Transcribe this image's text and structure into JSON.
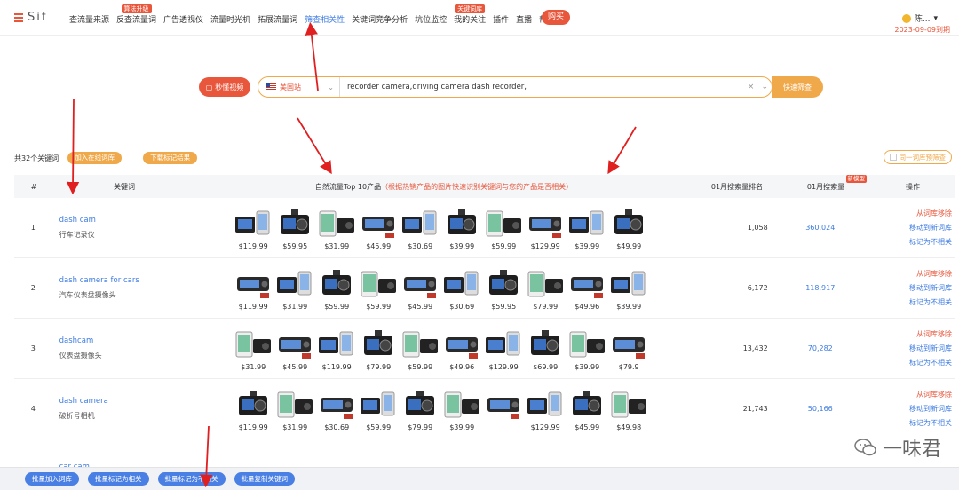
{
  "header": {
    "logo": "Sif",
    "nav": [
      {
        "label": "查流量来源",
        "badge": ""
      },
      {
        "label": "反查流量词",
        "badge": "算法升级"
      },
      {
        "label": "广告透视仪",
        "badge": ""
      },
      {
        "label": "流量时光机",
        "badge": ""
      },
      {
        "label": "拓展流量词",
        "badge": ""
      },
      {
        "label": "筛查相关性",
        "badge": "",
        "active": true
      },
      {
        "label": "关键词竞争分析",
        "badge": ""
      },
      {
        "label": "坑位监控",
        "badge": ""
      },
      {
        "label": "我的关注",
        "badge": "关键词库"
      },
      {
        "label": "插件",
        "badge": ""
      },
      {
        "label": "直播",
        "badge": ""
      },
      {
        "label": "帮助",
        "badge": ""
      }
    ],
    "buy_label": "购买",
    "user_name": "陈...",
    "expire_text": "2023-09-09到期"
  },
  "search": {
    "video_label": "秒懂视频",
    "site_label": "美国站",
    "query": "recorder camera,driving camera dash recorder,",
    "clear_icon": "×",
    "submit_label": "快速筛查"
  },
  "toolbar": {
    "total": "共32个关键词",
    "add_to_library": "加入在线词库",
    "download_results": "下载标记结果",
    "filter_label": "同一词库预筛查"
  },
  "table": {
    "headers": {
      "num": "#",
      "keyword": "关键词",
      "products": "自然流量Top 10产品",
      "products_hint": "（根据热销产品的图片快速识别关键词与您的产品是否相关）",
      "rank": "01月搜索量排名",
      "volume": "01月搜索量",
      "volume_tag": "新模型",
      "op": "操作"
    },
    "ops": {
      "remove": "从词库移除",
      "move": "移动到新词库",
      "mark": "标记为不相关"
    },
    "rows": [
      {
        "num": "1",
        "kw_en": "dash cam",
        "kw_cn": "行车记录仪",
        "rank": "1,058",
        "volume": "360,024",
        "prices": [
          "$119.99",
          "$59.95",
          "$31.99",
          "$45.99",
          "$30.69",
          "$39.99",
          "$59.99",
          "$129.99",
          "$39.99",
          "$49.99"
        ]
      },
      {
        "num": "2",
        "kw_en": "dash camera for cars",
        "kw_cn": "汽车仪表盘摄像头",
        "rank": "6,172",
        "volume": "118,917",
        "prices": [
          "$119.99",
          "$31.99",
          "$59.99",
          "$59.99",
          "$45.99",
          "$30.69",
          "$59.95",
          "$79.99",
          "$49.96",
          "$39.99"
        ]
      },
      {
        "num": "3",
        "kw_en": "dashcam",
        "kw_cn": "仪表盘摄像头",
        "rank": "13,432",
        "volume": "70,282",
        "prices": [
          "$31.99",
          "$45.99",
          "$119.99",
          "$79.99",
          "$59.99",
          "$49.96",
          "$129.99",
          "$69.99",
          "$39.99",
          "$79.9"
        ]
      },
      {
        "num": "4",
        "kw_en": "dash camera",
        "kw_cn": "破折号相机",
        "rank": "21,743",
        "volume": "50,166",
        "prices": [
          "$119.99",
          "$31.99",
          "$30.69",
          "$59.99",
          "$79.99",
          "$39.99",
          "",
          "$129.99",
          "$45.99",
          "$49.98"
        ]
      },
      {
        "num": "",
        "kw_en": "car cam",
        "kw_cn": "",
        "rank": "",
        "volume": "",
        "prices": [
          "",
          "",
          "",
          "",
          "",
          "",
          "",
          "",
          "",
          ""
        ]
      }
    ]
  },
  "bottom": {
    "buttons": [
      "批量加入词库",
      "批量标记为相关",
      "批量标记为不相关",
      "批量复制关键词"
    ]
  },
  "watermark": "一味君",
  "colors": {
    "accent": "#e8563b",
    "orange": "#f0a94a",
    "blue": "#3d7be0"
  }
}
